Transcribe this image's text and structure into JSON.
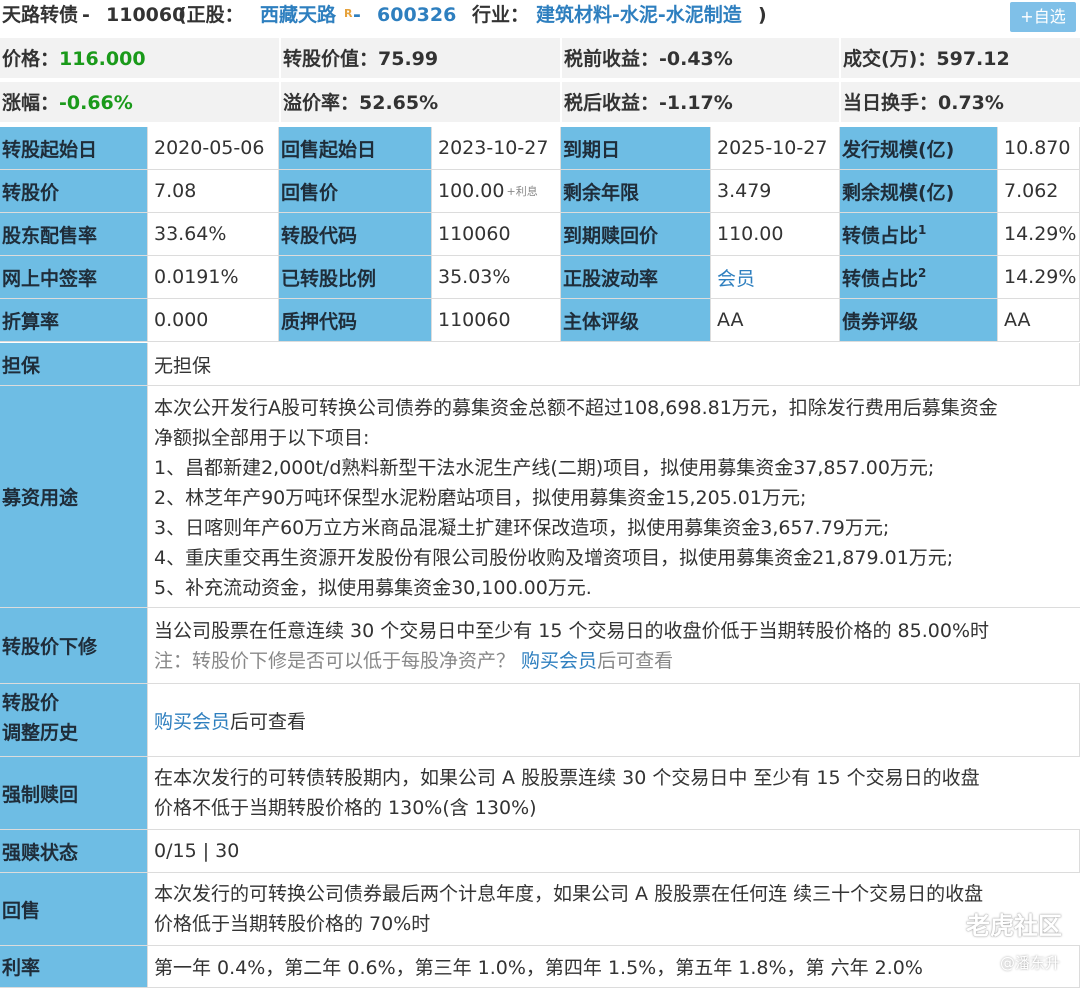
{
  "header": {
    "bond_name": "天路转债",
    "sep1": " - ",
    "bond_code": "110060",
    "paren_open": " (正股：",
    "stock_name": "西藏天路",
    "stock_badge": "R",
    "sep2": " - ",
    "stock_code": "600326",
    "industry_label": "行业：",
    "industry": "建筑材料-水泥-水泥制造",
    "paren_close": " )",
    "add_watch": "+自选"
  },
  "quote": {
    "price_label": "价格：",
    "price": "116.000",
    "conv_value_label": "转股价值：",
    "conv_value": "75.99",
    "pretax_label": "税前收益：",
    "pretax": "-0.43%",
    "volume_label": "成交(万)：",
    "volume": "597.12",
    "change_label": "涨幅：",
    "change": "-0.66%",
    "premium_label": "溢价率：",
    "premium": "52.65%",
    "aftertax_label": "税后收益：",
    "aftertax": "-1.17%",
    "turnover_label": "当日换手：",
    "turnover": "0.73%"
  },
  "table": {
    "r1": [
      "转股起始日",
      "2020-05-06",
      "回售起始日",
      "2023-10-27",
      "到期日",
      "2025-10-27",
      "发行规模(亿)",
      "10.870"
    ],
    "r2": [
      "转股价",
      "7.08",
      "回售价",
      "100.00",
      "剩余年限",
      "3.479",
      "剩余规模(亿)",
      "7.062"
    ],
    "r2_note": "+利息",
    "r3": [
      "股东配售率",
      "33.64%",
      "转股代码",
      "110060",
      "到期赎回价",
      "110.00",
      "转债占比",
      "14.29%"
    ],
    "r3_sup": "1",
    "r4": [
      "网上中签率",
      "0.0191%",
      "已转股比例",
      "35.03%",
      "正股波动率",
      "会员",
      "转债占比",
      "14.29%"
    ],
    "r4_sup": "2",
    "r5": [
      "折算率",
      "0.000",
      "质押代码",
      "110060",
      "主体评级",
      "AA",
      "债券评级",
      "AA"
    ]
  },
  "details": {
    "guarantee_label": "担保",
    "guarantee": "无担保",
    "funds_label": "募资用途",
    "funds_lines": [
      "本次公开发行A股可转换公司债券的募集资金总额不超过108,698.81万元，扣除发行费用后募集资金",
      "净额拟全部用于以下项目:",
      "1、昌都新建2,000t/d熟料新型干法水泥生产线(二期)项目，拟使用募集资金37,857.00万元;",
      "2、林芝年产90万吨环保型水泥粉磨站项目，拟使用募集资金15,205.01万元;",
      "3、日喀则年产60万立方米商品混凝土扩建环保改造项，拟使用募集资金3,657.79万元;",
      "4、重庆重交再生资源开发股份有限公司股份收购及增资项目，拟使用募集资金21,879.01万元;",
      "5、补充流动资金，拟使用募集资金30,100.00万元."
    ],
    "revise_label": "转股价下修",
    "revise_line1": "当公司股票在任意连续 30 个交易日中至少有 15 个交易日的收盘价低于当期转股价格的 85.00%时",
    "revise_note_prefix": "注：转股价下修是否可以低于每股净资产？ ",
    "revise_note_link": "购买会员",
    "revise_note_suffix": "后可查看",
    "history_label_1": "转股价",
    "history_label_2": "调整历史",
    "history_link": "购买会员",
    "history_suffix": "后可查看",
    "call_label": "强制赎回",
    "call_line1": "在本次发行的可转债转股期内，如果公司 A 股股票连续 30 个交易日中 至少有 15 个交易日的收盘",
    "call_line2": "价格不低于当期转股价格的 130%(含 130%)",
    "call_status_label": "强赎状态",
    "call_status": "0/15 | 30",
    "put_label": "回售",
    "put_line1": "本次发行的可转换公司债券最后两个计息年度，如果公司 A 股股票在任何连 续三十个交易日的收盘",
    "put_line2": "价格低于当期转股价格的 70%时",
    "rate_label": "利率",
    "rate": "第一年 0.4%，第二年 0.6%，第三年 1.0%，第四年 1.5%，第五年 1.8%，第 六年 2.0%"
  },
  "watermark": {
    "brand": "老虎社区",
    "author": "@潘东升"
  }
}
